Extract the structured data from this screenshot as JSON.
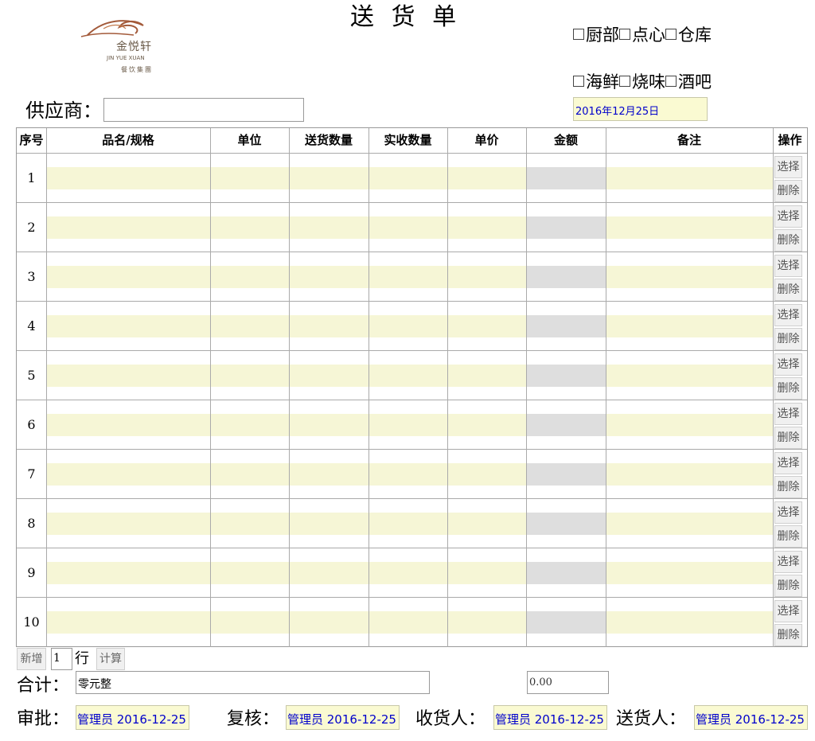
{
  "header": {
    "title": "送 货 单",
    "brand_name": "金悦轩",
    "brand_latin": "JIN YUE XUAN",
    "brand_group": "餐饮集團"
  },
  "departments": {
    "row1": [
      "厨部",
      "点心",
      "仓库"
    ],
    "row2": [
      "海鲜",
      "烧味",
      "酒吧"
    ]
  },
  "supplier": {
    "label": "供应商：",
    "value": ""
  },
  "date": "2016年12月25日",
  "table": {
    "columns": [
      "序号",
      "品名/规格",
      "单位",
      "送货数量",
      "实收数量",
      "单价",
      "金额",
      "备注",
      "操作"
    ],
    "rows": [
      "1",
      "2",
      "3",
      "4",
      "5",
      "6",
      "7",
      "8",
      "9",
      "10"
    ],
    "select_label": "选择",
    "delete_label": "删除"
  },
  "footer": {
    "add_label": "新增",
    "row_count": "1",
    "row_unit": "行",
    "calc_label": "计算",
    "total_label": "合计：",
    "total_words": "零元整",
    "total_amount": "0.00"
  },
  "signatures": [
    {
      "label": "审批：",
      "value": "管理员 2016-12-25"
    },
    {
      "label": "复核：",
      "value": "管理员 2016-12-25"
    },
    {
      "label": "收货人：",
      "value": "管理员 2016-12-25"
    },
    {
      "label": "送货人：",
      "value": "管理员 2016-12-25"
    }
  ],
  "colors": {
    "input_yellow": "#f6f6d6",
    "amount_gray": "#dedede",
    "date_text": "#0000cc"
  }
}
